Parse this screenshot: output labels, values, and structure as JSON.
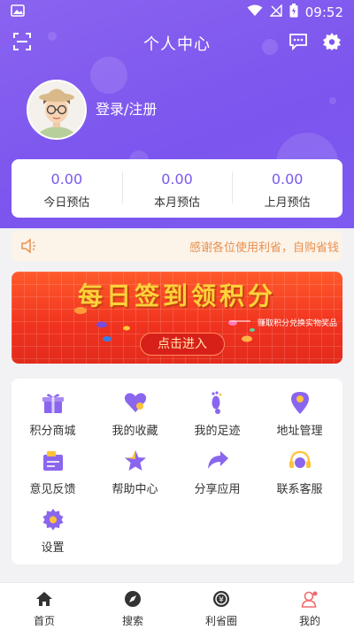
{
  "status_bar": {
    "time": "09:52"
  },
  "header": {
    "title": "个人中心"
  },
  "user": {
    "login_label": "登录/注册"
  },
  "stats": [
    {
      "value": "0.00",
      "label": "今日预估"
    },
    {
      "value": "0.00",
      "label": "本月预估"
    },
    {
      "value": "0.00",
      "label": "上月预估"
    }
  ],
  "notice": {
    "text": "感谢各位使用利省，自购省钱"
  },
  "banner": {
    "headline": "每日签到领积分",
    "subtitle": "赚取积分兑换实物奖品",
    "cta_label": "点击进入"
  },
  "menu": [
    {
      "label": "积分商城",
      "icon": "gift-icon"
    },
    {
      "label": "我的收藏",
      "icon": "heart-icon"
    },
    {
      "label": "我的足迹",
      "icon": "footprint-icon"
    },
    {
      "label": "地址管理",
      "icon": "location-pin-icon"
    },
    {
      "label": "意见反馈",
      "icon": "feedback-icon"
    },
    {
      "label": "帮助中心",
      "icon": "star-icon"
    },
    {
      "label": "分享应用",
      "icon": "share-arrow-icon"
    },
    {
      "label": "联系客服",
      "icon": "headset-icon"
    },
    {
      "label": "设置",
      "icon": "settings-icon"
    }
  ],
  "tabs": [
    {
      "label": "首页",
      "icon": "home-icon"
    },
    {
      "label": "搜索",
      "icon": "compass-icon"
    },
    {
      "label": "利省圈",
      "icon": "coin-icon"
    },
    {
      "label": "我的",
      "icon": "profile-icon",
      "active": true
    }
  ],
  "colors": {
    "accent": "#7b58ee",
    "notice_text": "#e8904e",
    "banner_red": "#f0321f",
    "tab_active": "#f06a6a"
  }
}
